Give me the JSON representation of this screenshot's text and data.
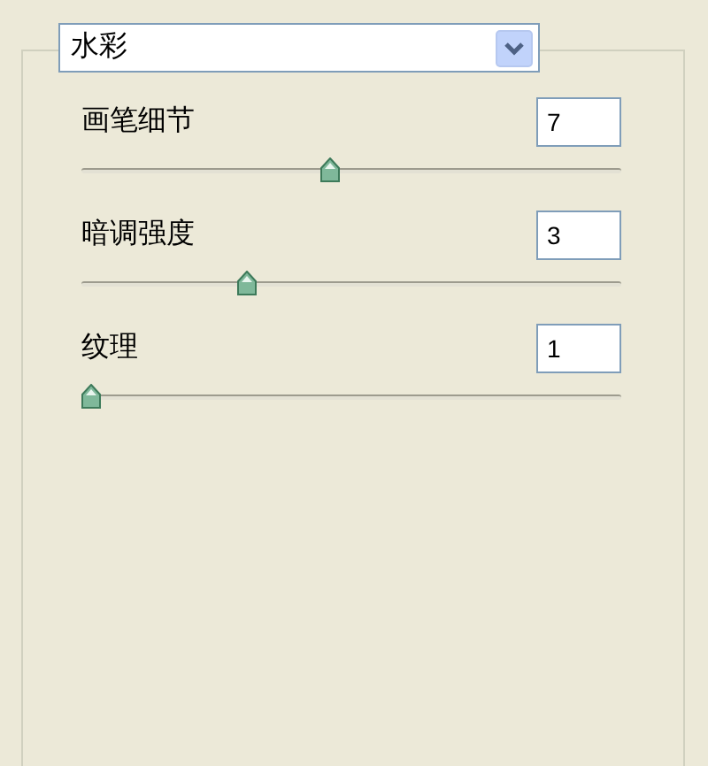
{
  "filter_dropdown": {
    "value": "水彩"
  },
  "settings": [
    {
      "label": "画笔细节",
      "value": "7",
      "level": 0.46
    },
    {
      "label": "暗调强度",
      "value": "3",
      "level": 0.3
    },
    {
      "label": "纹理",
      "value": "1",
      "level": 0
    }
  ]
}
